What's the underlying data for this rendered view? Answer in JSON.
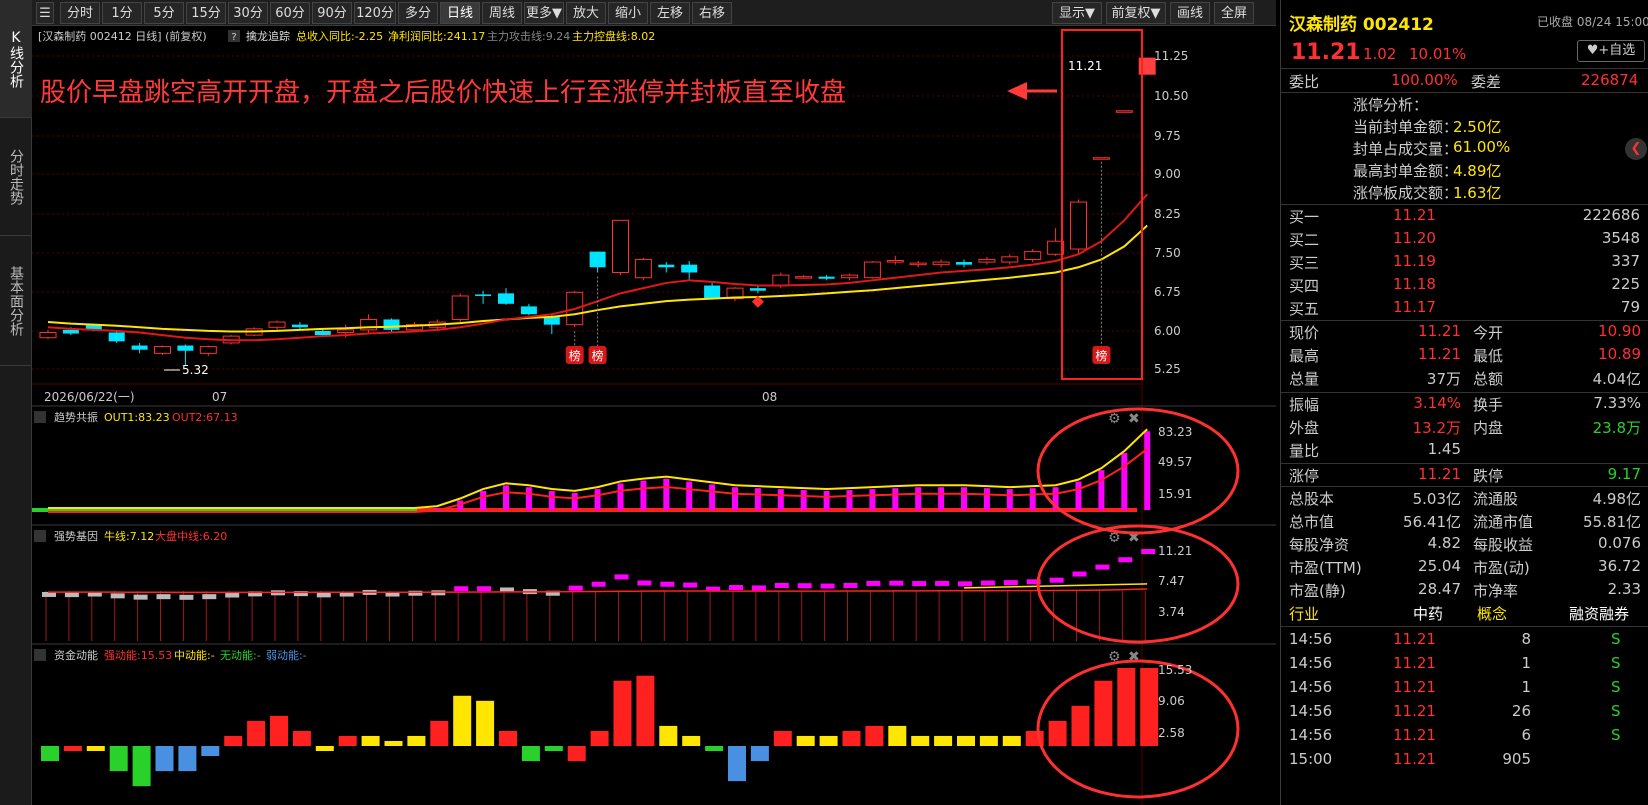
{
  "left_tabs": [
    "K线分析",
    "分时走势",
    "基本面分析"
  ],
  "toolbar": {
    "items": [
      "分时",
      "1分",
      "5分",
      "15分",
      "30分",
      "60分",
      "90分",
      "120分",
      "多分钟",
      "日线",
      "周线",
      "更多▼",
      "放大",
      "缩小",
      "左移",
      "右移"
    ],
    "active": "日线",
    "right_items": [
      "显示▼",
      "前复权▼",
      "画线",
      "全屏"
    ]
  },
  "chart": {
    "header": "[汉森制药 002412 日线]  (前复权)",
    "indicator_name": "擒龙追踪",
    "ind1": "总收入同比:-2.25",
    "ind2": "净利润同比:241.17",
    "ind3": "主力攻击线:9.24",
    "ind4": "主力控盘线:8.02",
    "annotation": "股价早盘跳空高开开盘，开盘之后股价快速上行至涨停并封板直至收盘",
    "last_price_label": "11.21",
    "low_label": "5.32",
    "bang": "榜",
    "date_start": "2026/06/22(一)",
    "date_07": "07",
    "date_08": "08",
    "price_ticks": [
      "11.25",
      "10.50",
      "9.75",
      "9.00",
      "8.25",
      "7.50",
      "6.75",
      "6.00",
      "5.25"
    ],
    "sub1": {
      "title": "趋势共振",
      "out1": "OUT1:83.23",
      "out2": "OUT2:67.13",
      "ticks": [
        "83.23",
        "49.57",
        "15.91"
      ]
    },
    "sub2": {
      "title": "强势基因",
      "l1": "牛线:7.12",
      "l2": "大盘中线:6.20",
      "ticks": [
        "11.21",
        "7.47",
        "3.74"
      ]
    },
    "sub3": {
      "title": "资金动能",
      "l1": "强动能:15.53",
      "l2": "中动能:-",
      "l3": "无动能:-",
      "l4": "弱动能:-",
      "ticks": [
        "15.53",
        "9.06",
        "2.58"
      ]
    }
  },
  "chart_data": {
    "type": "candlestick",
    "candles": [
      [
        5.85,
        5.95,
        5.82,
        6.0
      ],
      [
        6.0,
        5.93,
        5.9,
        6.05
      ],
      [
        6.1,
        6.0,
        5.97,
        6.12
      ],
      [
        5.95,
        5.78,
        5.75,
        5.98
      ],
      [
        5.7,
        5.62,
        5.55,
        5.75
      ],
      [
        5.55,
        5.68,
        5.52,
        5.7
      ],
      [
        5.7,
        5.6,
        5.32,
        5.72
      ],
      [
        5.55,
        5.68,
        5.5,
        5.7
      ],
      [
        5.75,
        5.88,
        5.72,
        5.9
      ],
      [
        5.9,
        6.02,
        5.88,
        6.05
      ],
      [
        6.05,
        6.15,
        6.0,
        6.18
      ],
      [
        6.1,
        6.05,
        6.0,
        6.15
      ],
      [
        5.98,
        5.9,
        5.87,
        6.02
      ],
      [
        5.95,
        6.0,
        5.85,
        6.1
      ],
      [
        6.0,
        6.2,
        5.95,
        6.3
      ],
      [
        6.2,
        6.0,
        5.95,
        6.22
      ],
      [
        6.0,
        6.1,
        5.98,
        6.15
      ],
      [
        6.05,
        6.15,
        6.0,
        6.2
      ],
      [
        6.2,
        6.65,
        6.15,
        6.7
      ],
      [
        6.68,
        6.65,
        6.5,
        6.75
      ],
      [
        6.7,
        6.5,
        6.48,
        6.8
      ],
      [
        6.45,
        6.3,
        6.28,
        6.5
      ],
      [
        6.25,
        6.1,
        5.92,
        6.28
      ],
      [
        6.1,
        6.72,
        6.05,
        6.75
      ],
      [
        7.5,
        7.2,
        7.1,
        7.5
      ],
      [
        7.1,
        8.1,
        7.05,
        8.1
      ],
      [
        7.0,
        7.35,
        6.95,
        7.38
      ],
      [
        7.25,
        7.2,
        7.1,
        7.3
      ],
      [
        7.25,
        7.1,
        6.95,
        7.32
      ],
      [
        6.85,
        6.6,
        6.58,
        6.9
      ],
      [
        6.6,
        6.8,
        6.55,
        6.82
      ],
      [
        6.8,
        6.75,
        6.7,
        6.85
      ],
      [
        6.85,
        7.05,
        6.8,
        7.1
      ],
      [
        7.0,
        7.02,
        6.98,
        7.05
      ],
      [
        7.02,
        6.98,
        6.95,
        7.05
      ],
      [
        7.0,
        7.05,
        6.95,
        7.08
      ],
      [
        7.0,
        7.3,
        6.98,
        7.32
      ],
      [
        7.3,
        7.33,
        7.25,
        7.42
      ],
      [
        7.25,
        7.28,
        7.2,
        7.32
      ],
      [
        7.25,
        7.3,
        7.2,
        7.35
      ],
      [
        7.3,
        7.25,
        7.2,
        7.35
      ],
      [
        7.3,
        7.35,
        7.25,
        7.4
      ],
      [
        7.3,
        7.4,
        7.25,
        7.45
      ],
      [
        7.35,
        7.5,
        7.3,
        7.55
      ],
      [
        7.45,
        7.7,
        7.42,
        7.95
      ],
      [
        7.55,
        8.45,
        7.45,
        8.5
      ],
      [
        9.3,
        9.3,
        9.3,
        9.3
      ],
      [
        10.2,
        10.2,
        10.2,
        10.2
      ],
      [
        10.9,
        11.21,
        10.89,
        11.21
      ]
    ],
    "ma_red": [
      6.05,
      6.02,
      6.0,
      5.98,
      5.95,
      5.9,
      5.85,
      5.82,
      5.8,
      5.8,
      5.82,
      5.85,
      5.88,
      5.9,
      5.93,
      5.95,
      5.97,
      6.0,
      6.05,
      6.12,
      6.2,
      6.25,
      6.3,
      6.4,
      6.55,
      6.7,
      6.8,
      6.9,
      6.95,
      6.92,
      6.88,
      6.85,
      6.85,
      6.86,
      6.87,
      6.9,
      6.95,
      7.0,
      7.05,
      7.1,
      7.13,
      7.16,
      7.2,
      7.25,
      7.32,
      7.45,
      7.7,
      8.1,
      8.6
    ],
    "ma_yellow": [
      6.15,
      6.12,
      6.1,
      6.08,
      6.05,
      6.02,
      6.0,
      5.98,
      5.97,
      5.97,
      5.98,
      6.0,
      6.02,
      6.03,
      6.05,
      6.06,
      6.08,
      6.1,
      6.13,
      6.17,
      6.2,
      6.23,
      6.25,
      6.3,
      6.38,
      6.45,
      6.5,
      6.55,
      6.58,
      6.6,
      6.62,
      6.63,
      6.65,
      6.67,
      6.7,
      6.73,
      6.76,
      6.8,
      6.84,
      6.88,
      6.92,
      6.96,
      7.0,
      7.05,
      7.1,
      7.2,
      7.35,
      7.6,
      8.0
    ],
    "sub1_bars": [
      0,
      0,
      0,
      0,
      0,
      0,
      0,
      0,
      0,
      0,
      0,
      0,
      0,
      0,
      0,
      0,
      0,
      2,
      10,
      20,
      26,
      24,
      20,
      18,
      22,
      28,
      31,
      33,
      30,
      27,
      24,
      23,
      22,
      21,
      20,
      21,
      22,
      23,
      24,
      24,
      24,
      23,
      22,
      23,
      24,
      30,
      42,
      60,
      83
    ],
    "sub3_bars": [
      -3,
      -1,
      -1,
      -5,
      -8,
      -5,
      -5,
      -2,
      2,
      5,
      6,
      3,
      -1,
      2,
      2,
      1,
      2,
      5,
      10,
      9,
      3,
      -3,
      -1,
      -3,
      3,
      13,
      14,
      4,
      2,
      -1,
      -7,
      -3,
      3,
      2,
      2,
      3,
      4,
      4,
      2,
      2,
      2,
      2,
      2,
      3,
      5,
      8,
      13,
      15.53,
      15.53
    ],
    "sub3_colors": [
      "#2bd12b",
      "#ff2020",
      "#ffe600",
      "#2bd12b",
      "#2bd12b",
      "#4a90e2",
      "#4a90e2",
      "#4a90e2",
      "#ff2020",
      "#ff2020",
      "#ff2020",
      "#ff2020",
      "#ffe600",
      "#ff2020",
      "#ffe600",
      "#ffe600",
      "#ffe600",
      "#ff2020",
      "#ffe600",
      "#ffe600",
      "#ff2020",
      "#2bd12b",
      "#2bd12b",
      "#ff2020",
      "#ff2020",
      "#ff2020",
      "#ff2020",
      "#ffe600",
      "#ffe600",
      "#2bd12b",
      "#4a90e2",
      "#4a90e2",
      "#ff2020",
      "#ffe600",
      "#ffe600",
      "#ff2020",
      "#ff2020",
      "#ffe600",
      "#ffe600",
      "#ffe600",
      "#ffe600",
      "#ffe600",
      "#ffe600",
      "#ff2020",
      "#ff2020",
      "#ff2020",
      "#ff2020",
      "#ff2020",
      "#ff2020"
    ]
  },
  "quote": {
    "name": "汉森制药 002412",
    "status": "已收盘 08/24 15:00",
    "price": "11.21",
    "change": "1.02",
    "pct": "10.01%",
    "watch": "+自选",
    "weibi_label": "委比",
    "weibi": "100.00%",
    "weicha_label": "委差",
    "weicha": "226874",
    "zt_title": "涨停分析：",
    "zt": [
      [
        "当前封单金额：",
        "2.50亿"
      ],
      [
        "封单占成交量：",
        "61.00%"
      ],
      [
        "最高封单金额：",
        "4.89亿"
      ],
      [
        "涨停板成交额：",
        "1.63亿"
      ]
    ],
    "bids": [
      [
        "买一",
        "11.21",
        "222686"
      ],
      [
        "买二",
        "11.20",
        "3548"
      ],
      [
        "买三",
        "11.19",
        "337"
      ],
      [
        "买四",
        "11.18",
        "225"
      ],
      [
        "买五",
        "11.17",
        "79"
      ]
    ],
    "stats1": [
      [
        "现价",
        "11.21",
        "今开",
        "10.90"
      ],
      [
        "最高",
        "11.21",
        "最低",
        "10.89"
      ],
      [
        "总量",
        "37万",
        "总额",
        "4.04亿"
      ]
    ],
    "stats2": [
      [
        "振幅",
        "3.14%",
        "换手",
        "7.33%"
      ],
      [
        "外盘",
        "13.2万",
        "内盘",
        "23.8万"
      ],
      [
        "量比",
        "1.45",
        "",
        ""
      ]
    ],
    "stats3": [
      [
        "涨停",
        "11.21",
        "跌停",
        "9.17"
      ]
    ],
    "stats4": [
      [
        "总股本",
        "5.03亿",
        "流通股",
        "4.98亿"
      ],
      [
        "总市值",
        "56.41亿",
        "流通市值",
        "55.81亿"
      ],
      [
        "每股净资",
        "4.82",
        "每股收益",
        "0.076"
      ],
      [
        "市盈(TTM)",
        "25.04",
        "市盈(动)",
        "36.72"
      ],
      [
        "市盈(静)",
        "28.47",
        "市净率",
        "2.33"
      ]
    ],
    "tabs": [
      "行业",
      "中药",
      "概念",
      "融资融券"
    ],
    "ticks": [
      [
        "14:56",
        "11.21",
        "8",
        "S"
      ],
      [
        "14:56",
        "11.21",
        "1",
        "S"
      ],
      [
        "14:56",
        "11.21",
        "1",
        "S"
      ],
      [
        "14:56",
        "11.21",
        "26",
        "S"
      ],
      [
        "14:56",
        "11.21",
        "6",
        "S"
      ],
      [
        "15:00",
        "11.21",
        "905",
        ""
      ]
    ]
  }
}
